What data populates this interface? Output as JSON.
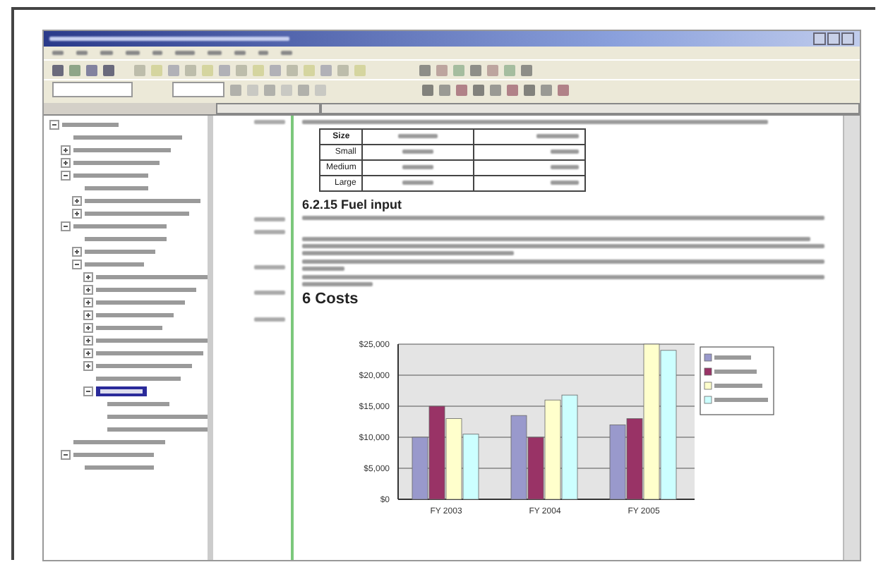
{
  "tree": [
    {
      "expanded": true,
      "selected": false,
      "children": [
        {
          "selected": false
        },
        {
          "expanded": false,
          "selected": false
        },
        {
          "expanded": false,
          "selected": false
        },
        {
          "expanded": true,
          "selected": false,
          "children": [
            {
              "selected": false
            },
            {
              "expanded": false,
              "selected": false
            },
            {
              "expanded": false,
              "selected": false
            }
          ]
        },
        {
          "expanded": true,
          "selected": false,
          "children": [
            {
              "selected": false
            },
            {
              "expanded": false,
              "selected": false
            },
            {
              "expanded": true,
              "selected": false,
              "children": [
                {
                  "expanded": false,
                  "selected": false
                },
                {
                  "expanded": false,
                  "selected": false
                },
                {
                  "expanded": false,
                  "selected": false
                },
                {
                  "expanded": false,
                  "selected": false
                },
                {
                  "expanded": false,
                  "selected": false
                },
                {
                  "expanded": false,
                  "selected": false
                },
                {
                  "expanded": false,
                  "selected": false
                },
                {
                  "expanded": false,
                  "selected": false
                },
                {
                  "selected": false
                },
                {
                  "expanded": true,
                  "selected": true,
                  "children": [
                    {
                      "selected": false
                    },
                    {
                      "selected": false
                    },
                    {
                      "selected": false
                    }
                  ]
                }
              ]
            }
          ]
        },
        {
          "selected": false
        },
        {
          "expanded": true,
          "selected": false,
          "children": [
            {
              "selected": false
            }
          ]
        }
      ]
    }
  ],
  "table": {
    "rows": [
      {
        "size": "Size"
      },
      {
        "size": "Small"
      },
      {
        "size": "Medium"
      },
      {
        "size": "Large"
      }
    ]
  },
  "heading": "6.2.15 Fuel input",
  "costs_heading": "6 Costs",
  "chart_data": {
    "type": "bar",
    "grid": true,
    "categories": [
      "FY 2003",
      "FY 2004",
      "FY 2005"
    ],
    "yticks": [
      {
        "value": 0,
        "label": "$0"
      },
      {
        "value": 5000,
        "label": "$5,000"
      },
      {
        "value": 10000,
        "label": "$10,000"
      },
      {
        "value": 15000,
        "label": "$15,000"
      },
      {
        "value": 20000,
        "label": "$20,000"
      },
      {
        "value": 25000,
        "label": "$25,000"
      }
    ],
    "ylim": [
      0,
      25000
    ],
    "series": [
      {
        "color": "#9999cc",
        "values": [
          10000,
          13500,
          12000
        ]
      },
      {
        "color": "#993366",
        "values": [
          15000,
          10000,
          13000
        ]
      },
      {
        "color": "#ffffcc",
        "values": [
          13000,
          16000,
          25000
        ]
      },
      {
        "color": "#ccffff",
        "values": [
          10500,
          16800,
          24000
        ]
      }
    ]
  }
}
